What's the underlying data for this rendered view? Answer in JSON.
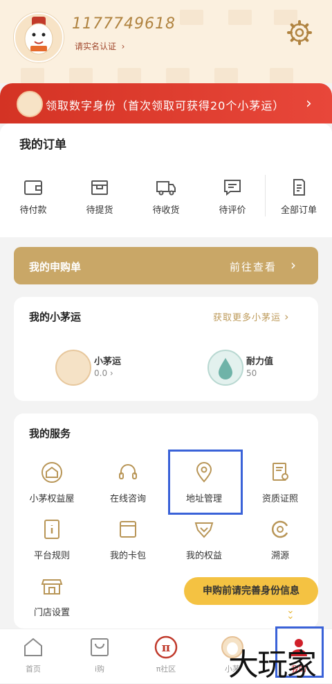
{
  "header": {
    "phone": "1177749618",
    "verify_label": "请实名认证"
  },
  "banner": {
    "text": "领取数字身份（首次领取可获得20个小茅运）"
  },
  "orders": {
    "title": "我的订单",
    "items": [
      {
        "label": "待付款",
        "icon": "wallet-icon"
      },
      {
        "label": "待提货",
        "icon": "box-icon"
      },
      {
        "label": "待收货",
        "icon": "truck-icon"
      },
      {
        "label": "待评价",
        "icon": "comment-icon"
      },
      {
        "label": "全部订单",
        "icon": "document-icon"
      }
    ]
  },
  "purchase": {
    "title": "我的申购单",
    "link": "前往查看"
  },
  "maoyun": {
    "title": "我的小茅运",
    "link": "获取更多小茅运",
    "stats": [
      {
        "label": "小茅运",
        "value": "0.0"
      },
      {
        "label": "耐力值",
        "value": "50"
      }
    ]
  },
  "services": {
    "title": "我的服务",
    "items": [
      {
        "label": "小茅权益屋",
        "icon": "house-icon"
      },
      {
        "label": "在线咨询",
        "icon": "headset-icon"
      },
      {
        "label": "地址管理",
        "icon": "location-pin-icon"
      },
      {
        "label": "资质证照",
        "icon": "certificate-icon"
      },
      {
        "label": "平台规则",
        "icon": "info-book-icon"
      },
      {
        "label": "我的卡包",
        "icon": "card-wallet-icon"
      },
      {
        "label": "我的权益",
        "icon": "heart-badge-icon"
      },
      {
        "label": "溯源",
        "icon": "trace-icon"
      },
      {
        "label": "门店设置",
        "icon": "store-icon"
      }
    ]
  },
  "toast": "申购前请完善身份信息",
  "tabs": [
    {
      "label": "首页",
      "icon": "home-icon"
    },
    {
      "label": "i购",
      "icon": "bag-icon"
    },
    {
      "label": "π社区",
      "icon": "pi-icon"
    },
    {
      "label": "小茅",
      "icon": "mascot-icon"
    },
    {
      "label": "我的",
      "icon": "user-icon"
    }
  ],
  "watermark": "大玩家",
  "colors": {
    "gold": "#c9a767",
    "banner_red": "#d43324",
    "highlight_blue": "#3a62d8",
    "toast_yellow": "#f4c242"
  }
}
